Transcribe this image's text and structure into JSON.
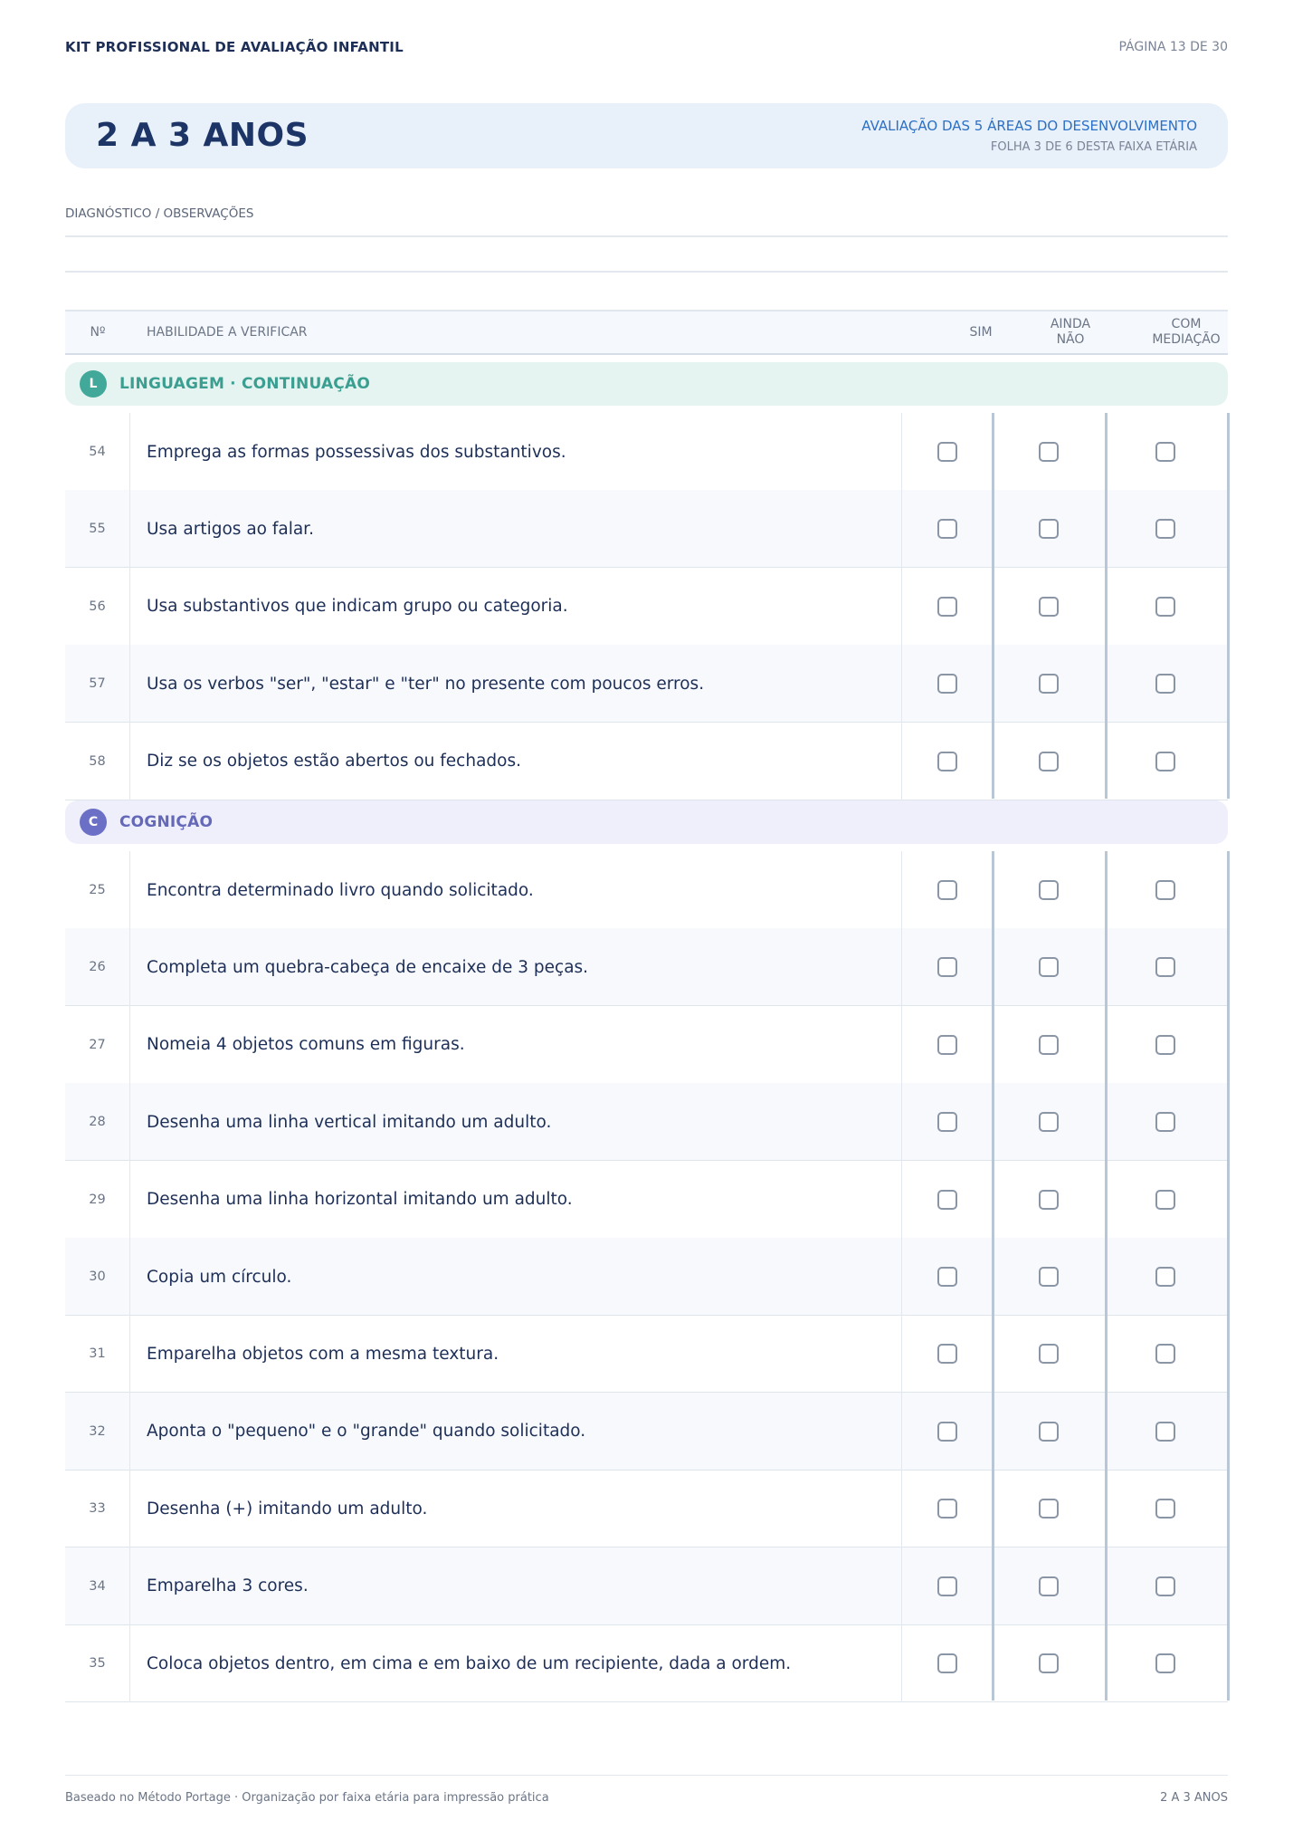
{
  "header": {
    "doc_title": "KIT PROFISSIONAL DE AVALIAÇÃO INFANTIL",
    "page": "PÁGINA 13 DE 30"
  },
  "band": {
    "title": "2 A 3 ANOS",
    "subtitle": "AVALIAÇÃO DAS 5 ÁREAS DO DESENVOLVIMENTO",
    "sheet": "FOLHA 3 DE 6 DESTA FAIXA ETÁRIA"
  },
  "observations": {
    "label": "DIAGNÓSTICO / OBSERVAÇÕES"
  },
  "table": {
    "col_num": "Nº",
    "col_skill": "HABILIDADE A VERIFICAR",
    "col_yes": "SIM",
    "col_not_yet_1": "AINDA",
    "col_not_yet_2": "NÃO",
    "col_mediation_1": "COM",
    "col_mediation_2": "MEDIAÇÃO"
  },
  "sections": [
    {
      "badge": "L",
      "title": "LINGUAGEM · CONTINUAÇÃO",
      "color": "#41a89a",
      "items": [
        {
          "num": "54",
          "text": "Emprega as formas possessivas dos substantivos."
        },
        {
          "num": "55",
          "text": "Usa artigos ao falar."
        },
        {
          "num": "56",
          "text": "Usa substantivos que indicam grupo ou categoria."
        },
        {
          "num": "57",
          "text": "Usa os verbos \"ser\", \"estar\" e \"ter\" no presente com poucos erros."
        },
        {
          "num": "58",
          "text": "Diz se os objetos estão abertos ou fechados."
        }
      ]
    },
    {
      "badge": "C",
      "title": "COGNIÇÃO",
      "color": "#6b70c6",
      "items": [
        {
          "num": "25",
          "text": "Encontra determinado livro quando solicitado."
        },
        {
          "num": "26",
          "text": "Completa um quebra-cabeça de encaixe de 3 peças."
        },
        {
          "num": "27",
          "text": "Nomeia 4 objetos comuns em figuras."
        },
        {
          "num": "28",
          "text": "Desenha uma linha vertical imitando um adulto."
        },
        {
          "num": "29",
          "text": "Desenha uma linha horizontal imitando um adulto."
        },
        {
          "num": "30",
          "text": "Copia um círculo."
        },
        {
          "num": "31",
          "text": "Emparelha objetos com a mesma textura."
        },
        {
          "num": "32",
          "text": "Aponta o \"pequeno\" e o \"grande\" quando solicitado."
        },
        {
          "num": "33",
          "text": "Desenha (+) imitando um adulto."
        },
        {
          "num": "34",
          "text": "Emparelha 3 cores."
        },
        {
          "num": "35",
          "text": "Coloca objetos dentro, em cima e em baixo de um recipiente, dada a ordem."
        }
      ]
    }
  ],
  "footer": {
    "left": "Baseado no Método Portage · Organização por faixa etária para impressão prática",
    "right": "2 A 3 ANOS"
  }
}
